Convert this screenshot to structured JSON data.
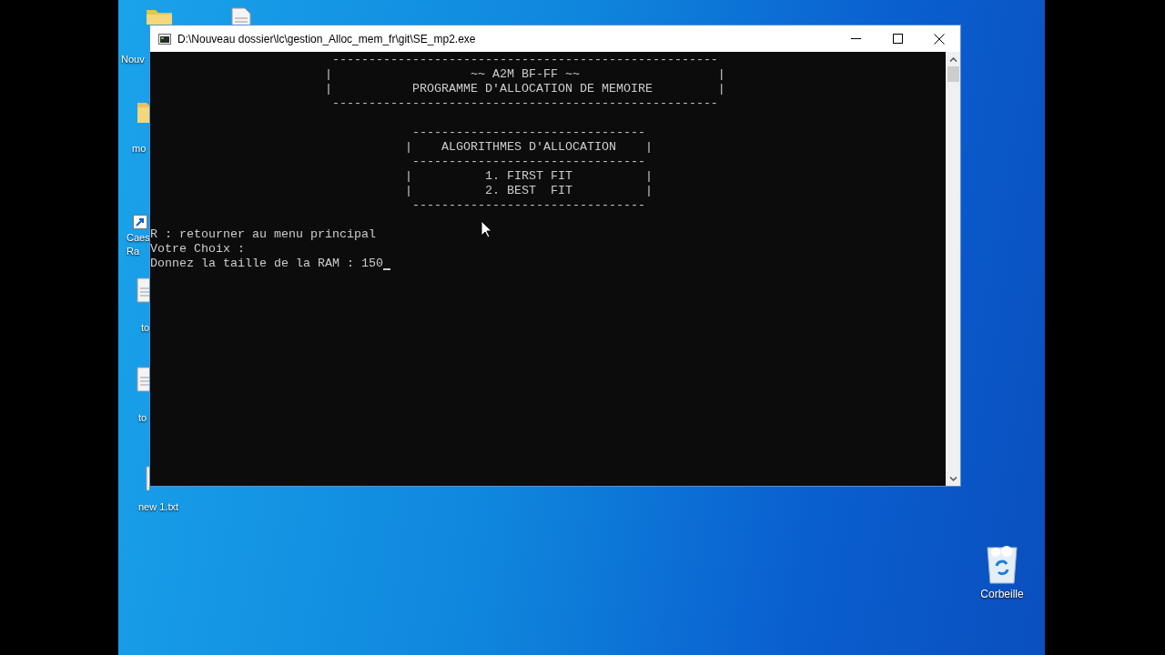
{
  "desktop": {
    "icons": [
      {
        "kind": "folder",
        "label": [
          "Nouv"
        ]
      },
      {
        "kind": "folder",
        "label": [
          "mo"
        ]
      },
      {
        "kind": "shortcut",
        "label": [
          "Caes",
          "Ra"
        ]
      },
      {
        "kind": "file",
        "label": [
          "to"
        ]
      },
      {
        "kind": "file",
        "label": [
          "to"
        ]
      },
      {
        "kind": "file",
        "label": [
          "new 1.txt"
        ]
      },
      {
        "kind": "file"
      }
    ],
    "recycle_bin": {
      "label": "Corbeille"
    }
  },
  "window": {
    "title": "D:\\Nouveau dossier\\lc\\gestion_Alloc_mem_fr\\git\\SE_mp2.exe",
    "console_blocks": [
      [
        "                         -----------------------------------------------------",
        "                        |                   ~~ A2M BF-FF ~~                   |",
        "                        |           PROGRAMME D'ALLOCATION DE MEMOIRE         |",
        "                         -----------------------------------------------------"
      ],
      [
        "                                    --------------------------------",
        "                                   |    ALGORITHMES D'ALLOCATION    |",
        "                                    --------------------------------",
        "                                   |          1. FIRST FIT          |",
        "                                   |          2. BEST  FIT          |",
        "                                    --------------------------------"
      ],
      [
        "R : retourner au menu principal",
        "Votre Choix :",
        "Donnez la taille de la RAM : 150"
      ]
    ]
  }
}
